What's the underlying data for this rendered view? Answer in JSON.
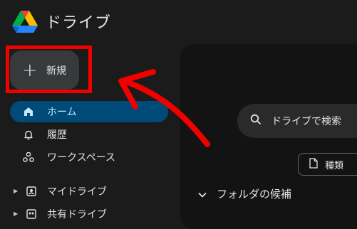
{
  "app": {
    "title": "ドライブ",
    "logo_icon": "google-drive-logo"
  },
  "new_button": {
    "label": "新規",
    "icon": "plus-icon"
  },
  "sidebar": {
    "items": [
      {
        "label": "ホーム",
        "icon": "home-icon",
        "active": true
      },
      {
        "label": "履歴",
        "icon": "bell-icon"
      },
      {
        "label": "ワークスペース",
        "icon": "workspaces-icon"
      },
      {
        "label": "マイドライブ",
        "icon": "my-drive-icon",
        "expandable": true
      },
      {
        "label": "共有ドライブ",
        "icon": "shared-drives-icon",
        "expandable": true
      }
    ]
  },
  "search": {
    "placeholder": "ドライブで検索",
    "icon": "search-icon"
  },
  "filters": {
    "type_label": "種類",
    "icon": "document-icon"
  },
  "folders": {
    "header": "フォルダの候補",
    "icon": "chevron-down-icon"
  },
  "annotation": {
    "color": "#f10000"
  },
  "colors": {
    "active_bg": "#004a77",
    "active_text": "#c2e7ff",
    "background": "#1b1b1b"
  }
}
